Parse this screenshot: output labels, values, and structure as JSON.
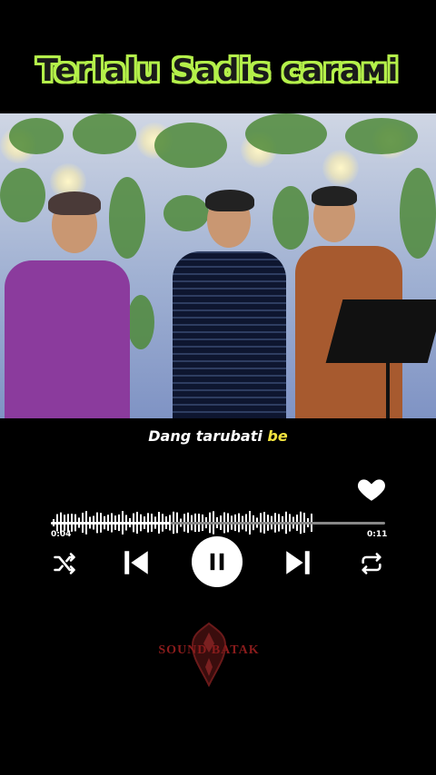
{
  "title": "Terlalu Sadis caraмi",
  "lyrics": {
    "main": "Dang tarubati ",
    "highlight": "be"
  },
  "player": {
    "current_time": "0:04",
    "total_time": "0:11",
    "progress": 0.36,
    "liked": true
  },
  "controls": {
    "shuffle": "shuffle-icon",
    "previous": "skip-previous-icon",
    "play_pause": "pause-icon",
    "next": "skip-next-icon",
    "repeat": "repeat-icon"
  },
  "watermark": "SOUND BATAK",
  "colors": {
    "title_outline": "#b4f04a",
    "lyric_highlight": "#f1e23f",
    "logo": "#8a1c1c"
  }
}
